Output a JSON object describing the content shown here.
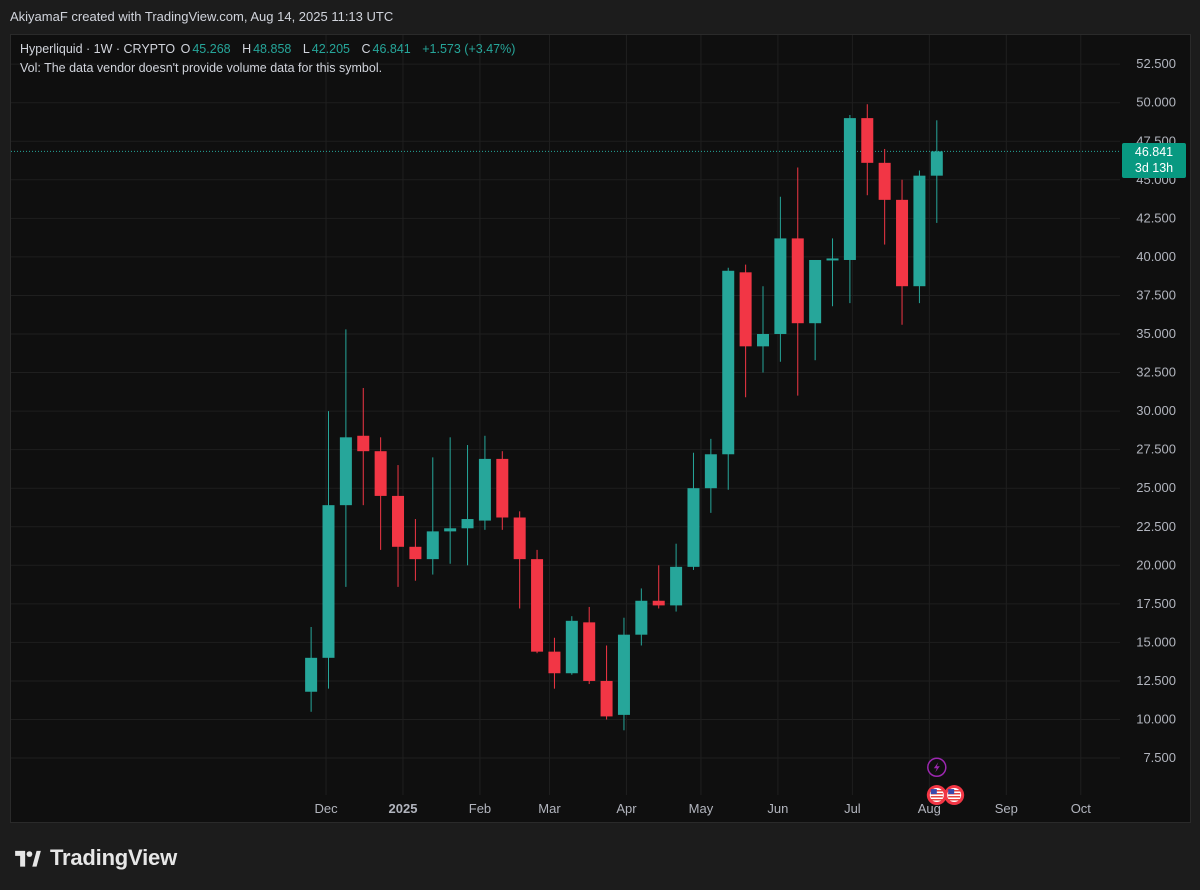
{
  "header": {
    "caption": "AkiyamaF created with TradingView.com, Aug 14, 2025 11:13 UTC"
  },
  "legend": {
    "symbol": "Hyperliquid · 1W · CRYPTO",
    "o_label": "O",
    "o_value": "45.268",
    "h_label": "H",
    "h_value": "48.858",
    "l_label": "L",
    "l_value": "42.205",
    "c_label": "C",
    "c_value": "46.841",
    "change": "+1.573 (+3.47%)",
    "volume_note": "Vol: The data vendor doesn't provide volume data for this symbol."
  },
  "last_price": {
    "price": "46.841",
    "countdown": "3d 13h"
  },
  "footer": {
    "brand": "TradingView"
  },
  "colors": {
    "up": "#26a69a",
    "down": "#f23645",
    "grid": "#1f1f1f",
    "event_lightning": "#9c27b0",
    "last_price_bg": "#089981"
  },
  "icons": [
    "lightning-event-icon",
    "us-flag-event-icon",
    "tradingview-logo-icon"
  ],
  "chart_data": {
    "type": "candlestick",
    "ylim": [
      5,
      55
    ],
    "y_ticks": [
      "7.500",
      "10.000",
      "12.500",
      "15.000",
      "17.500",
      "20.000",
      "22.500",
      "25.000",
      "27.500",
      "30.000",
      "32.500",
      "35.000",
      "37.500",
      "40.000",
      "42.500",
      "45.000",
      "47.500",
      "50.000",
      "52.500"
    ],
    "x_ticks": [
      {
        "label": "Dec",
        "date": "2024-12-01",
        "bold": false
      },
      {
        "label": "2025",
        "date": "2025-01-01",
        "bold": true
      },
      {
        "label": "Feb",
        "date": "2025-02-01",
        "bold": false
      },
      {
        "label": "Mar",
        "date": "2025-03-01",
        "bold": false
      },
      {
        "label": "Apr",
        "date": "2025-04-01",
        "bold": false
      },
      {
        "label": "May",
        "date": "2025-05-01",
        "bold": false
      },
      {
        "label": "Jun",
        "date": "2025-06-01",
        "bold": false
      },
      {
        "label": "Jul",
        "date": "2025-07-01",
        "bold": false
      },
      {
        "label": "Aug",
        "date": "2025-08-01",
        "bold": false
      },
      {
        "label": "Sep",
        "date": "2025-09-01",
        "bold": false
      },
      {
        "label": "Oct",
        "date": "2025-10-01",
        "bold": false
      }
    ],
    "candles": [
      {
        "date": "2024-11-25",
        "o": 11.8,
        "h": 16.0,
        "l": 10.5,
        "c": 14.0
      },
      {
        "date": "2024-12-02",
        "o": 14.0,
        "h": 30.0,
        "l": 12.0,
        "c": 23.9
      },
      {
        "date": "2024-12-09",
        "o": 23.9,
        "h": 35.3,
        "l": 18.6,
        "c": 28.3
      },
      {
        "date": "2024-12-16",
        "o": 28.4,
        "h": 31.5,
        "l": 23.9,
        "c": 27.4
      },
      {
        "date": "2024-12-23",
        "o": 27.4,
        "h": 28.3,
        "l": 21.0,
        "c": 24.5
      },
      {
        "date": "2024-12-30",
        "o": 24.5,
        "h": 26.5,
        "l": 18.6,
        "c": 21.2
      },
      {
        "date": "2025-01-06",
        "o": 21.2,
        "h": 23.0,
        "l": 19.0,
        "c": 20.4
      },
      {
        "date": "2025-01-13",
        "o": 20.4,
        "h": 27.0,
        "l": 19.4,
        "c": 22.2
      },
      {
        "date": "2025-01-20",
        "o": 22.2,
        "h": 28.3,
        "l": 20.1,
        "c": 22.4
      },
      {
        "date": "2025-01-27",
        "o": 22.4,
        "h": 27.8,
        "l": 20.0,
        "c": 23.0
      },
      {
        "date": "2025-02-03",
        "o": 22.9,
        "h": 28.4,
        "l": 22.3,
        "c": 26.9
      },
      {
        "date": "2025-02-10",
        "o": 26.9,
        "h": 27.4,
        "l": 22.3,
        "c": 23.1
      },
      {
        "date": "2025-02-17",
        "o": 23.1,
        "h": 23.5,
        "l": 17.2,
        "c": 20.4
      },
      {
        "date": "2025-02-24",
        "o": 20.4,
        "h": 21.0,
        "l": 14.3,
        "c": 14.4
      },
      {
        "date": "2025-03-03",
        "o": 14.4,
        "h": 15.3,
        "l": 12.0,
        "c": 13.0
      },
      {
        "date": "2025-03-10",
        "o": 13.0,
        "h": 16.7,
        "l": 12.9,
        "c": 16.4
      },
      {
        "date": "2025-03-17",
        "o": 16.3,
        "h": 17.3,
        "l": 12.3,
        "c": 12.5
      },
      {
        "date": "2025-03-24",
        "o": 12.5,
        "h": 14.8,
        "l": 10.0,
        "c": 10.2
      },
      {
        "date": "2025-03-31",
        "o": 10.3,
        "h": 16.6,
        "l": 9.3,
        "c": 15.5
      },
      {
        "date": "2025-04-07",
        "o": 15.5,
        "h": 18.5,
        "l": 14.8,
        "c": 17.7
      },
      {
        "date": "2025-04-14",
        "o": 17.7,
        "h": 20.0,
        "l": 17.2,
        "c": 17.4
      },
      {
        "date": "2025-04-21",
        "o": 17.4,
        "h": 21.4,
        "l": 17.0,
        "c": 19.9
      },
      {
        "date": "2025-04-28",
        "o": 19.9,
        "h": 27.3,
        "l": 19.7,
        "c": 25.0
      },
      {
        "date": "2025-05-05",
        "o": 25.0,
        "h": 28.2,
        "l": 23.4,
        "c": 27.2
      },
      {
        "date": "2025-05-12",
        "o": 27.2,
        "h": 39.3,
        "l": 24.9,
        "c": 39.1
      },
      {
        "date": "2025-05-19",
        "o": 39.0,
        "h": 39.5,
        "l": 30.9,
        "c": 34.2
      },
      {
        "date": "2025-05-26",
        "o": 34.2,
        "h": 38.1,
        "l": 32.5,
        "c": 35.0
      },
      {
        "date": "2025-06-02",
        "o": 35.0,
        "h": 43.9,
        "l": 33.2,
        "c": 41.2
      },
      {
        "date": "2025-06-09",
        "o": 41.2,
        "h": 45.8,
        "l": 31.0,
        "c": 35.7
      },
      {
        "date": "2025-06-16",
        "o": 35.7,
        "h": 39.8,
        "l": 33.3,
        "c": 39.8
      },
      {
        "date": "2025-06-23",
        "o": 39.8,
        "h": 41.2,
        "l": 36.8,
        "c": 39.9
      },
      {
        "date": "2025-06-30",
        "o": 39.8,
        "h": 49.2,
        "l": 37.0,
        "c": 49.0
      },
      {
        "date": "2025-07-07",
        "o": 49.0,
        "h": 49.9,
        "l": 44.0,
        "c": 46.1
      },
      {
        "date": "2025-07-14",
        "o": 46.1,
        "h": 47.0,
        "l": 40.8,
        "c": 43.7
      },
      {
        "date": "2025-07-21",
        "o": 43.7,
        "h": 45.0,
        "l": 35.6,
        "c": 38.1
      },
      {
        "date": "2025-07-28",
        "o": 38.1,
        "h": 45.6,
        "l": 37.0,
        "c": 45.268
      },
      {
        "date": "2025-08-04",
        "o": 45.268,
        "h": 48.858,
        "l": 42.205,
        "c": 46.841
      }
    ],
    "events": [
      {
        "type": "lightning",
        "date": "2025-08-04",
        "price": 6.9
      },
      {
        "type": "us-flag",
        "date": "2025-08-04",
        "price": 5.1
      },
      {
        "type": "us-flag",
        "date": "2025-08-11",
        "price": 5.1
      }
    ]
  }
}
